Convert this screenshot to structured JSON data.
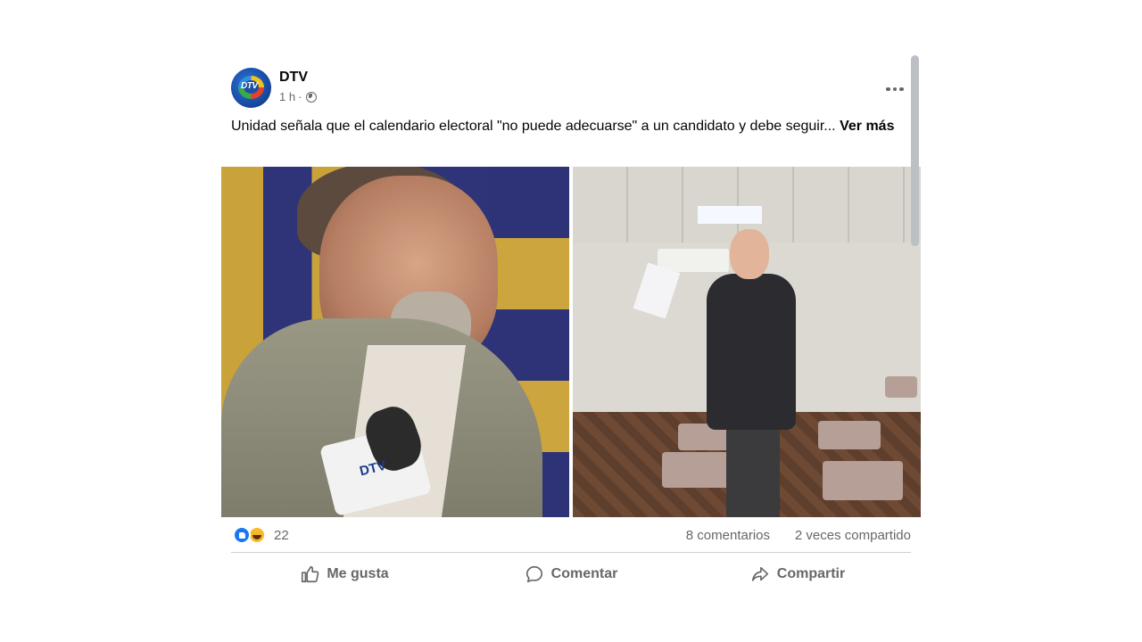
{
  "post": {
    "page_name": "DTV",
    "timestamp": "1 h",
    "separator": "·",
    "privacy_icon": "globe-icon",
    "avatar_logo": "DTV",
    "text": "Unidad señala que el calendario electoral \"no puede adecuarse\" a un candidato y debe seguir...",
    "see_more": "Ver más",
    "more_icon": "more-horizontal-icon"
  },
  "media": {
    "left_photo_caption_visible": "DTV",
    "photos": [
      "man-speaking-to-microphone",
      "man-holding-paper-thumbs-up"
    ]
  },
  "stats": {
    "reaction_icons": [
      "like-icon",
      "haha-icon"
    ],
    "reactions": "22",
    "comments": "8 comentarios",
    "shares": "2 veces compartido"
  },
  "actions": {
    "like": "Me gusta",
    "comment": "Comentar",
    "share": "Compartir"
  },
  "colors": {
    "accent": "#1877f2",
    "secondary_text": "#65676b",
    "divider": "#ced0d4"
  }
}
